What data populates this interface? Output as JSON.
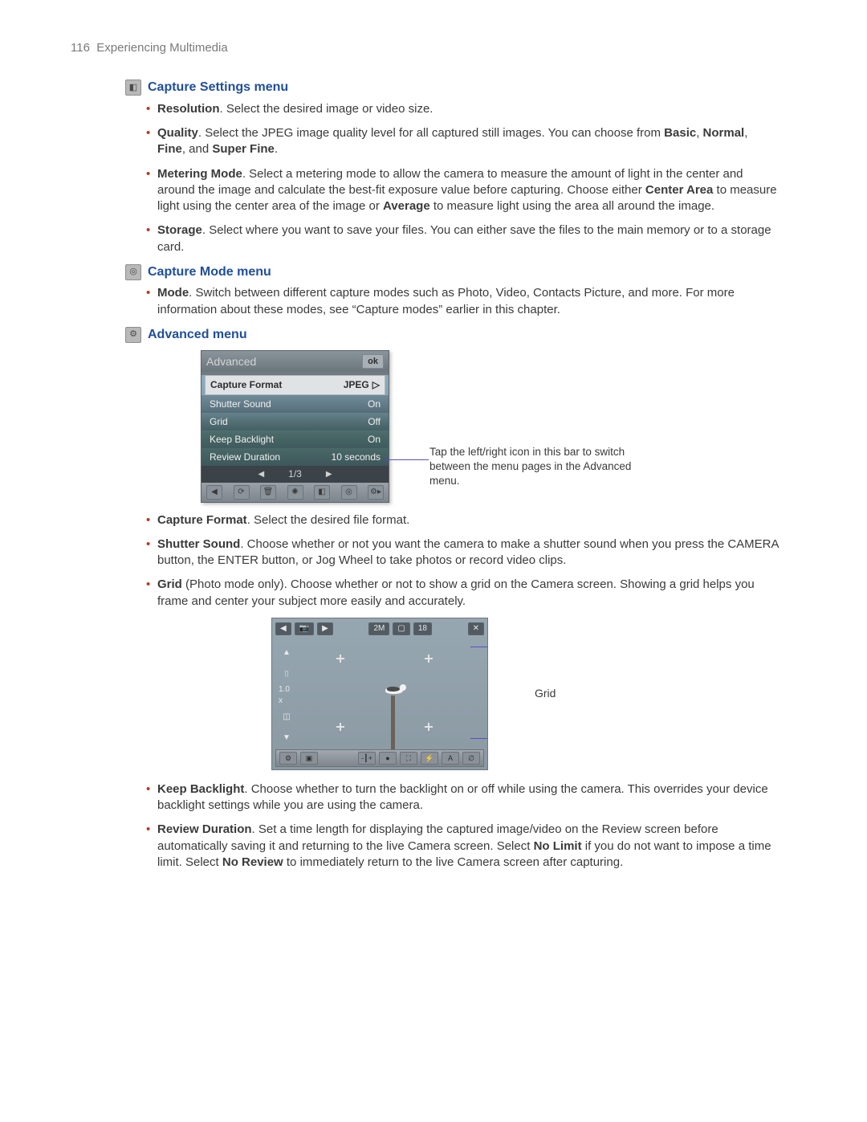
{
  "page": {
    "number": "116",
    "title": "Experiencing Multimedia"
  },
  "sections": {
    "capture_settings": {
      "heading": "Capture Settings menu",
      "items": {
        "resolution": {
          "label": "Resolution",
          "text": ". Select the desired image or video size."
        },
        "quality": {
          "label": "Quality",
          "text_a": ". Select the JPEG image quality level for all captured still images. You can choose from ",
          "b1": "Basic",
          "b2": "Normal",
          "b3": "Fine",
          "b4": "Super Fine",
          "tail": "."
        },
        "metering": {
          "label": "Metering Mode",
          "text_a": ". Select a metering mode to allow the camera to measure the amount of light in the center and around the image and calculate the best-fit exposure value before capturing. Choose either ",
          "b1": "Center Area",
          "text_b": " to measure light using the center area of the image or ",
          "b2": "Average",
          "text_c": " to measure light using the area all around the image."
        },
        "storage": {
          "label": "Storage",
          "text": ". Select where you want to save your files. You can either save the files to the main memory or to a storage card."
        }
      }
    },
    "capture_mode": {
      "heading": "Capture Mode menu",
      "items": {
        "mode": {
          "label": "Mode",
          "text": ". Switch between different capture modes such as Photo, Video, Contacts Picture, and more. For more information about these modes, see “Capture modes” earlier in this chapter."
        }
      }
    },
    "advanced": {
      "heading": "Advanced menu",
      "menu": {
        "title": "Advanced",
        "ok": "ok",
        "rows": {
          "capture_format": {
            "label": "Capture Format",
            "value": "JPEG"
          },
          "shutter_sound": {
            "label": "Shutter Sound",
            "value": "On"
          },
          "grid": {
            "label": "Grid",
            "value": "Off"
          },
          "keep_backlight": {
            "label": "Keep Backlight",
            "value": "On"
          },
          "review_duration": {
            "label": "Review Duration",
            "value": "10 seconds"
          }
        },
        "pager": "1/3"
      },
      "callout": "Tap the left/right icon in this bar to switch between the menu pages in the Advanced menu.",
      "items": {
        "capture_format": {
          "label": "Capture Format",
          "text": ". Select the desired file format."
        },
        "shutter_sound": {
          "label": "Shutter Sound",
          "text": ". Choose whether or not you want the camera to make a shutter sound when you press the CAMERA button, the ENTER button, or Jog Wheel to take photos or record video clips."
        },
        "grid": {
          "label": "Grid",
          "note": " (Photo mode only). ",
          "text": "Choose whether or not to show a grid on the Camera screen. Showing a grid helps you frame and center your subject more easily and accurately."
        },
        "keep_backlight": {
          "label": "Keep Backlight",
          "text": ". Choose whether to turn the backlight on or off while using the camera. This overrides your device backlight settings while you are using the camera."
        },
        "review_duration": {
          "label": "Review Duration",
          "text_a": ". Set a time length for displaying the captured image/video on the Review screen before automatically saving it and returning to the live Camera screen. Select ",
          "b1": "No Limit",
          "text_b": " if you do not want to impose a time limit. Select ",
          "b2": "No Review",
          "text_c": "  to immediately return to the live Camera screen after capturing."
        }
      },
      "camera": {
        "counter": "18",
        "zoom": "1.0 x",
        "res": "2M",
        "grid_label": "Grid"
      }
    }
  }
}
